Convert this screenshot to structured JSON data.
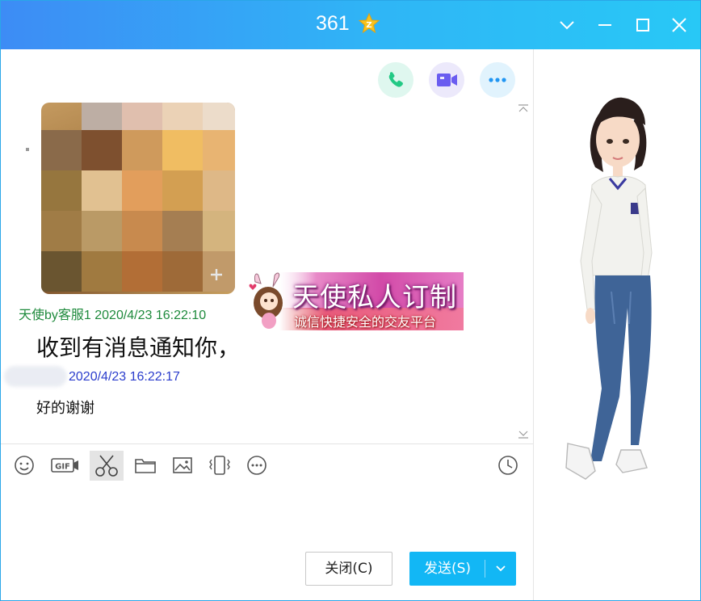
{
  "window": {
    "title": "361",
    "accent": "#12b7f5"
  },
  "messages": [
    {
      "sender_time": "天使by客服1 2020/4/23 16:22:10",
      "text": "收到有消息通知你，",
      "color": "#1e8a3c"
    },
    {
      "sender_time": "2020/4/23 16:22:17",
      "text": "好的谢谢",
      "color": "#2a3ccc"
    }
  ],
  "banner": {
    "line1": "天使私人订制",
    "line2": "诚信快捷安全的交友平台"
  },
  "toolbar": {
    "icons": [
      "emoji-icon",
      "gif-icon",
      "scissors-icon",
      "folder-icon",
      "image-icon",
      "vibrate-icon",
      "more-icon",
      "history-icon"
    ]
  },
  "actions": {
    "close_label": "关闭(C)",
    "send_label": "发送(S)"
  }
}
